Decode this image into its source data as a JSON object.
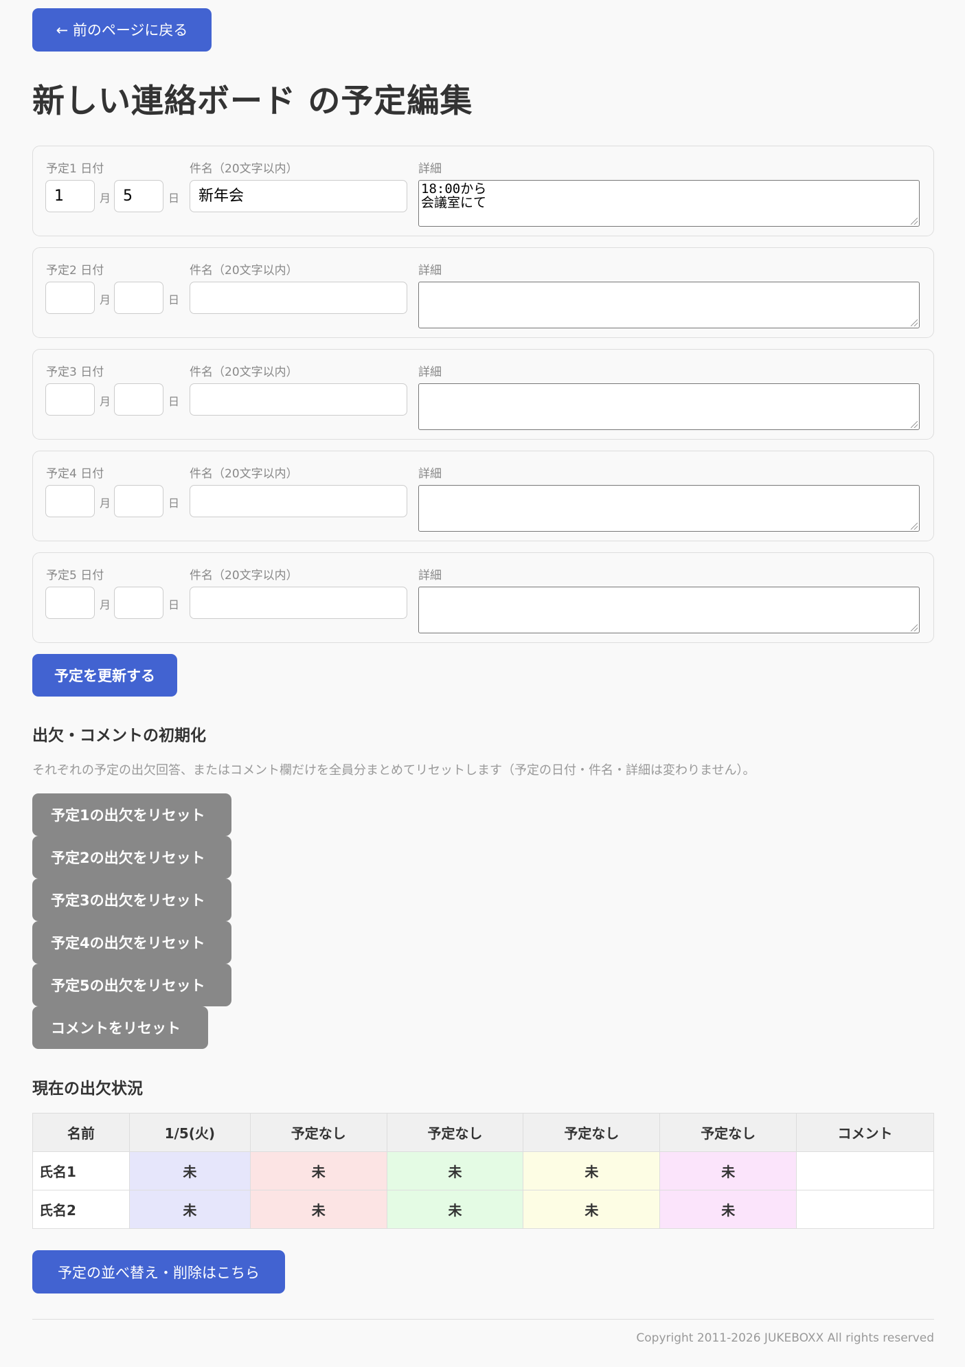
{
  "nav": {
    "back_label": "← 前のページに戻る"
  },
  "page_title": "新しい連絡ボード の予定編集",
  "schedule_form": {
    "month_unit": "月",
    "day_unit": "日",
    "name_label": "件名（20文字以内）",
    "detail_label": "詳細",
    "items": [
      {
        "date_label": "予定1 日付",
        "month": "1",
        "day": "5",
        "title": "新年会",
        "detail": "18:00から\n会議室にて"
      },
      {
        "date_label": "予定2 日付",
        "month": "",
        "day": "",
        "title": "",
        "detail": ""
      },
      {
        "date_label": "予定3 日付",
        "month": "",
        "day": "",
        "title": "",
        "detail": ""
      },
      {
        "date_label": "予定4 日付",
        "month": "",
        "day": "",
        "title": "",
        "detail": ""
      },
      {
        "date_label": "予定5 日付",
        "month": "",
        "day": "",
        "title": "",
        "detail": ""
      }
    ],
    "submit_label": "予定を更新する"
  },
  "reset_section": {
    "heading": "出欠・コメントの初期化",
    "description": "それぞれの予定の出欠回答、またはコメント欄だけを全員分まとめてリセットします（予定の日付・件名・詳細は変わりません）。",
    "buttons": [
      "予定1の出欠をリセット",
      "予定2の出欠をリセット",
      "予定3の出欠をリセット",
      "予定4の出欠をリセット",
      "予定5の出欠をリセット",
      "コメントをリセット"
    ]
  },
  "status_section": {
    "heading": "現在の出欠状況",
    "headers": [
      "名前",
      "1/5(火)",
      "予定なし",
      "予定なし",
      "予定なし",
      "予定なし",
      "コメント"
    ],
    "column_colors": [
      "#e6e6fb",
      "#fce4e4",
      "#e4fbe4",
      "#fdfde4",
      "#fbe4fb"
    ],
    "rows": [
      {
        "name": "氏名1",
        "cells": [
          "未",
          "未",
          "未",
          "未",
          "未"
        ],
        "comment": ""
      },
      {
        "name": "氏名2",
        "cells": [
          "未",
          "未",
          "未",
          "未",
          "未"
        ],
        "comment": ""
      }
    ]
  },
  "sort_link_label": "予定の並べ替え・削除はこちら",
  "footer": {
    "copyright": "Copyright 2011-2026 JUKEBOXX All rights reserved"
  },
  "colors": {
    "primary": "#4263d1",
    "secondary": "#888888",
    "background": "#f9f9f9"
  }
}
